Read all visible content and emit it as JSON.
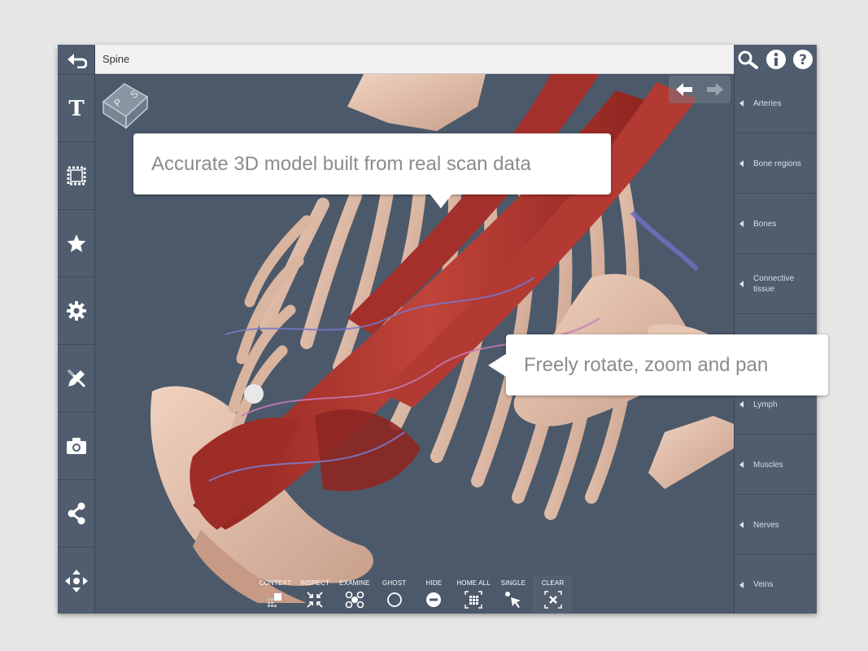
{
  "title_bar": {
    "title": "Spine"
  },
  "top_right_icons": [
    "search-icon",
    "info-icon",
    "help-icon"
  ],
  "left_toolbar": {
    "back_icon": "back-icon",
    "items": [
      {
        "name": "text-tool",
        "icon": "text-icon"
      },
      {
        "name": "select-tool",
        "icon": "selection-icon"
      },
      {
        "name": "favorites",
        "icon": "star-icon"
      },
      {
        "name": "settings",
        "icon": "gear-icon"
      },
      {
        "name": "draw-tool",
        "icon": "pencil-icon"
      },
      {
        "name": "screenshot",
        "icon": "camera-icon"
      },
      {
        "name": "share",
        "icon": "share-icon"
      },
      {
        "name": "move-tool",
        "icon": "move-icon"
      }
    ]
  },
  "nav_cube": {
    "labels": [
      "S",
      "P"
    ]
  },
  "history_arrows": [
    "undo-arrow-icon",
    "redo-arrow-icon"
  ],
  "right_panel": {
    "items": [
      {
        "label": "Arteries"
      },
      {
        "label": "Bone regions"
      },
      {
        "label": "Bones"
      },
      {
        "label": "Connective tissue"
      },
      {
        "label": ""
      },
      {
        "label": "Lymph"
      },
      {
        "label": "Muscles"
      },
      {
        "label": "Nerves"
      },
      {
        "label": "Veins"
      }
    ]
  },
  "bottom_toolbar": {
    "buttons": [
      {
        "label": "CONTEXT",
        "icon": "context-icon"
      },
      {
        "label": "INSPECT",
        "icon": "inspect-icon"
      },
      {
        "label": "EXAMINE",
        "icon": "examine-icon"
      },
      {
        "label": "GHOST",
        "icon": "ghost-icon"
      },
      {
        "label": "HIDE",
        "icon": "hide-icon"
      },
      {
        "label": "HOME ALL",
        "icon": "home-all-icon"
      },
      {
        "label": "SINGLE",
        "icon": "single-select-icon"
      },
      {
        "label": "CLEAR",
        "icon": "clear-icon"
      }
    ]
  },
  "callouts": {
    "model": "Accurate 3D model built from real scan data",
    "controls": "Freely rotate, zoom and pan"
  },
  "colors": {
    "viewport_bg": "#4c596a",
    "toolbar_bg": "#4f5d6e",
    "bone": "#dcb8a2",
    "muscle": "#a8322d",
    "vein": "#6f6fc0"
  }
}
